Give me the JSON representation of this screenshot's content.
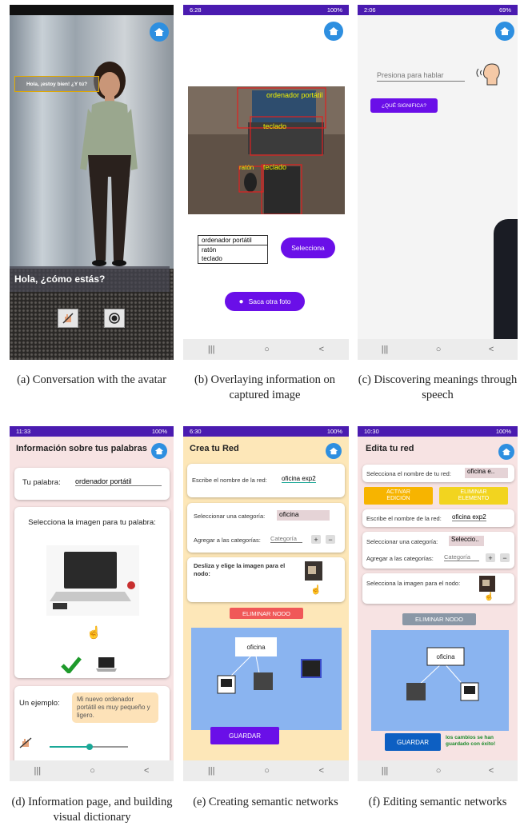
{
  "panel_a": {
    "speech_bubble": "Hola, ¡estoy bien! ¿Y tú?",
    "user_text": "Hola, ¿cómo estás?",
    "caption": "(a) Conversation with the avatar"
  },
  "panel_b": {
    "status_time": "6:28",
    "status_right": "100%",
    "labels": [
      "ordenador portátil",
      "teclado",
      "ratón",
      "teclado"
    ],
    "list_items": [
      "ordenador portátil",
      "ratón",
      "teclado"
    ],
    "select_button": "Selecciona",
    "photo_button": "Saca otra foto",
    "caption": "(b) Overlaying information on captured image"
  },
  "panel_c": {
    "status_time": "2:06",
    "status_right": "69%",
    "input_placeholder": "Presiona para hablar",
    "meaning_button": "¿QUÉ SIGNIFICA?",
    "caption": "(c) Discovering meanings through speech"
  },
  "panel_d": {
    "status_time": "11:33",
    "status_right": "100%",
    "title": "Información sobre tus palabras",
    "word_label": "Tu palabra:",
    "word_value": "ordenador portátil",
    "image_prompt": "Selecciona la imagen para tu palabra:",
    "example_label": "Un ejemplo:",
    "example_text": "Mi nuevo ordenador portátil es muy pequeño y ligero.",
    "caption": "(d) Information page, and building visual dictionary"
  },
  "panel_e": {
    "status_time": "6:30",
    "status_right": "100%",
    "title": "Crea tu Red",
    "network_name_label": "Escribe el nombre de la red:",
    "network_name_value": "oficina exp2",
    "category_label": "Seleccionar una categoría:",
    "category_value": "oficina",
    "add_category_label": "Agregar a las categorías:",
    "add_category_placeholder": "Categoría",
    "image_label": "Desliza y elige la imagen para el nodo:",
    "delete_node_button": "ELIMINAR NODO",
    "node_label": "oficina",
    "save_button": "GUARDAR",
    "caption": "(e) Creating semantic networks"
  },
  "panel_f": {
    "status_time": "10:30",
    "status_right": "100%",
    "title": "Edita tu red",
    "select_name_label": "Selecciona el nombre de tu red:",
    "select_name_value": "oficina e..",
    "activate_edit_button": "ACTIVAR EDICIÓN",
    "delete_element_button": "ELIMINAR ELEMENTO",
    "network_name_label": "Escribe el nombre de la red:",
    "network_name_value": "oficina exp2",
    "category_label": "Seleccionar una categoría:",
    "category_value": "Seleccio..",
    "add_category_label": "Agregar a las categorías:",
    "add_category_placeholder": "Categoría",
    "image_label": "Selecciona la imagen para el nodo:",
    "delete_node_button": "ELIMINAR NODO",
    "node_label": "oficina",
    "save_button": "GUARDAR",
    "save_message": "los cambios se han guardado con éxito!",
    "caption": "(f) Editing semantic networks"
  }
}
